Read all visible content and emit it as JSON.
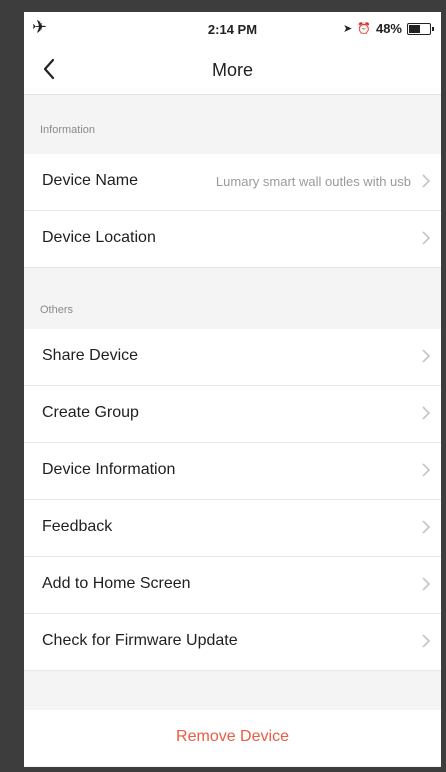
{
  "status_bar": {
    "time": "2:14 PM",
    "battery_text": "48%"
  },
  "nav": {
    "title": "More",
    "back_icon": "chevron-left-icon"
  },
  "sections": [
    {
      "header": "Information",
      "items": [
        {
          "label": "Device Name",
          "value": "Lumary smart wall outles with usb"
        },
        {
          "label": "Device Location",
          "value": ""
        }
      ]
    },
    {
      "header": "Others",
      "items": [
        {
          "label": "Share Device"
        },
        {
          "label": "Create Group"
        },
        {
          "label": "Device Information"
        },
        {
          "label": "Feedback"
        },
        {
          "label": "Add to Home Screen"
        },
        {
          "label": "Check for Firmware Update"
        }
      ]
    }
  ],
  "remove_button": {
    "label": "Remove Device",
    "color": "#ee5a43"
  }
}
